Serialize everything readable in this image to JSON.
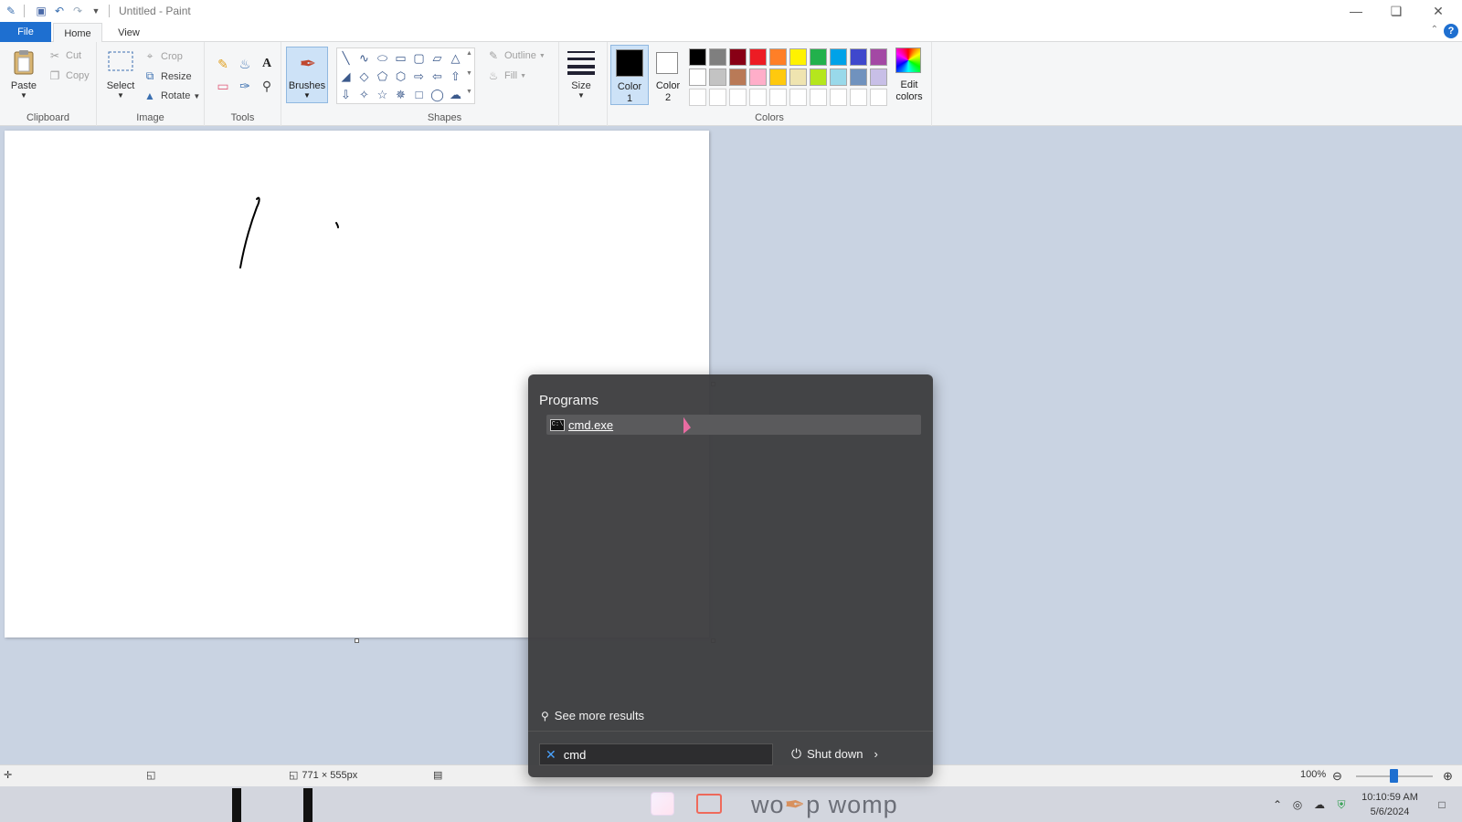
{
  "window": {
    "title": "Untitled - Paint"
  },
  "tabs": {
    "file": "File",
    "home": "Home",
    "view": "View"
  },
  "ribbon": {
    "clipboard": {
      "label": "Clipboard",
      "paste": "Paste",
      "cut": "Cut",
      "copy": "Copy"
    },
    "image": {
      "label": "Image",
      "select": "Select",
      "crop": "Crop",
      "resize": "Resize",
      "rotate": "Rotate"
    },
    "tools": {
      "label": "Tools"
    },
    "brushes": {
      "label": "Brushes"
    },
    "shapes": {
      "label": "Shapes",
      "outline": "Outline",
      "fill": "Fill"
    },
    "size": {
      "label": "Size"
    },
    "colors": {
      "label": "Colors",
      "color1": "Color 1",
      "color2": "Color 2",
      "edit": "Edit colors",
      "color1_value": "#000000",
      "color2_value": "#ffffff",
      "palette_row1": [
        "#000000",
        "#7f7f7f",
        "#880015",
        "#ed1c24",
        "#ff7f27",
        "#fff200",
        "#22b14c",
        "#00a2e8",
        "#3f48cc",
        "#a349a4"
      ],
      "palette_row2": [
        "#ffffff",
        "#c3c3c3",
        "#b97a57",
        "#ffaec9",
        "#ffc90e",
        "#efe4b0",
        "#b5e61d",
        "#99d9ea",
        "#7092be",
        "#c8bfe7"
      ]
    }
  },
  "statusbar": {
    "dimensions": "771 × 555px",
    "zoom": "100%"
  },
  "start_menu": {
    "heading": "Programs",
    "results": [
      {
        "label": "cmd.exe"
      }
    ],
    "see_more": "See more results",
    "search_value": "cmd",
    "shutdown": "Shut down"
  },
  "taskbar": {
    "time": "10:10:59 AM",
    "date": "5/6/2024"
  }
}
